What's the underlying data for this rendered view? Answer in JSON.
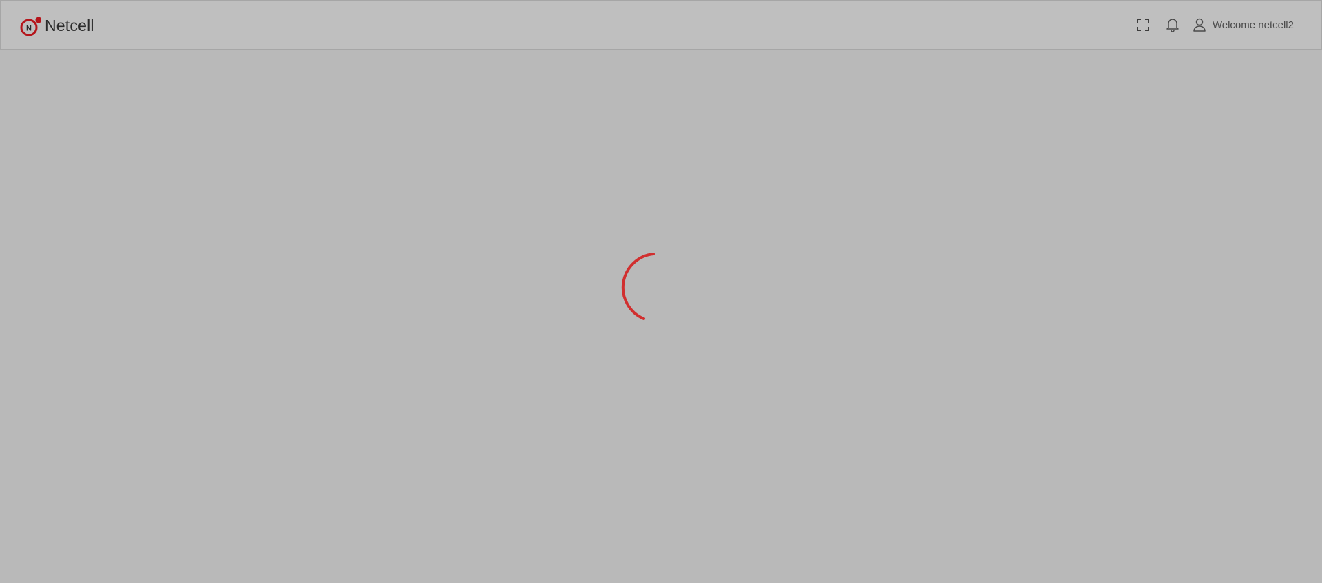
{
  "app": {
    "brand_name": "Netcell",
    "logo_letter": "N",
    "brand_color": "#b5151b"
  },
  "header": {
    "fullscreen_icon": "fullscreen-icon",
    "notification_icon": "bell-icon",
    "user_icon": "user-icon",
    "welcome_text": "Welcome netcell2"
  },
  "main": {
    "loading_indicator": "spinner-icon",
    "spinner_color": "#d12f2f"
  }
}
